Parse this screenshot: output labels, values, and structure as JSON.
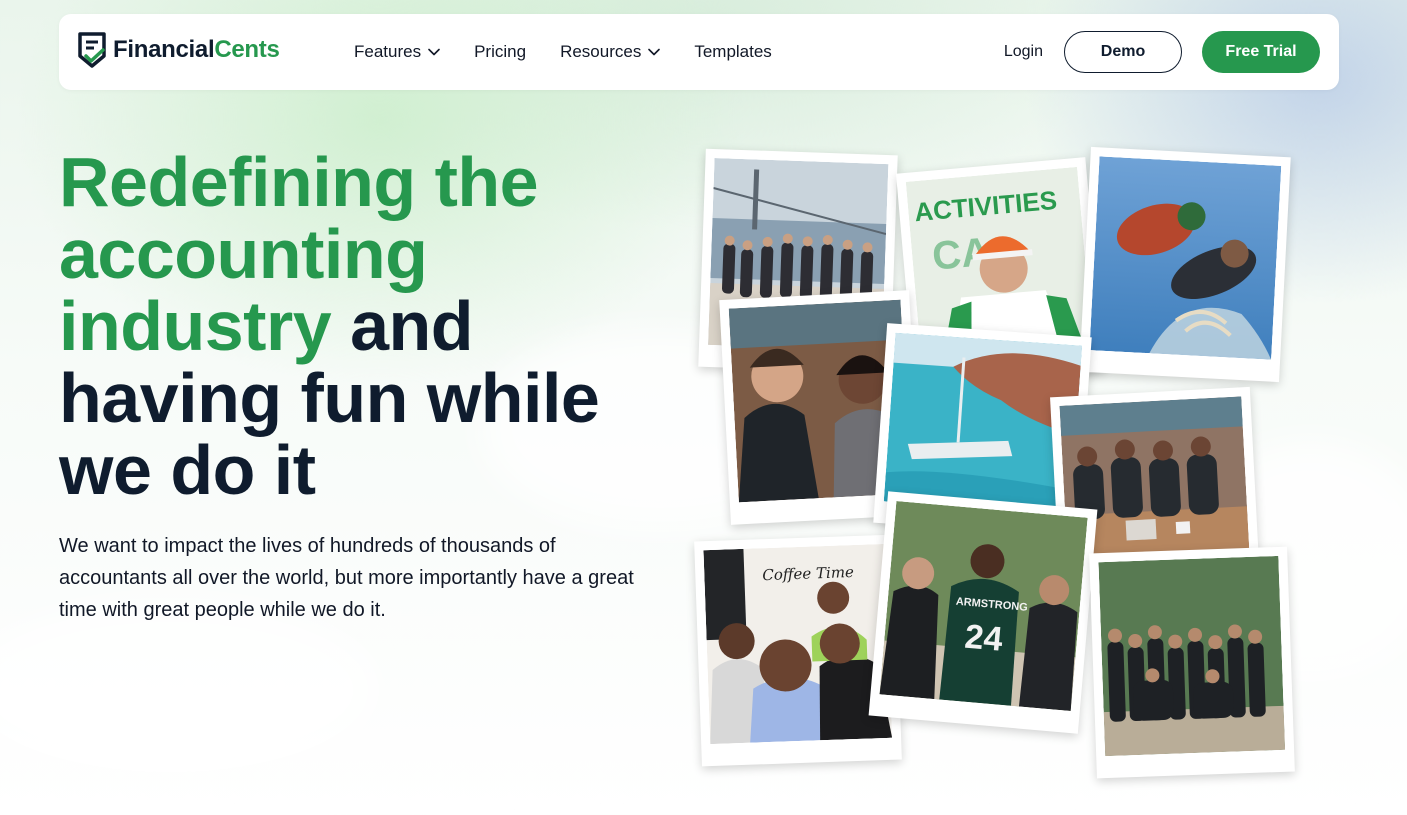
{
  "nav": {
    "logo": {
      "part1": "Financial",
      "part2": "Cents"
    },
    "links": [
      {
        "label": "Features",
        "dropdown": true
      },
      {
        "label": "Pricing",
        "dropdown": false
      },
      {
        "label": "Resources",
        "dropdown": true
      },
      {
        "label": "Templates",
        "dropdown": false
      }
    ],
    "login": "Login",
    "demo": "Demo",
    "free_trial": "Free Trial"
  },
  "hero": {
    "title_green": "Redefining the accounting industry",
    "title_dark": " and having fun while we do it",
    "description": "We want to impact the lives of hundreds of thousands of accountants all over the world, but more importantly have a great time with great people while we do it."
  },
  "collage": {
    "sign_text": "ACTIVITIES",
    "jersey_name": "ARMSTRONG",
    "jersey_number": "24",
    "mug_text": "Coffee Time"
  },
  "colors": {
    "brand_green": "#26984e",
    "navy": "#0f1c2e"
  }
}
